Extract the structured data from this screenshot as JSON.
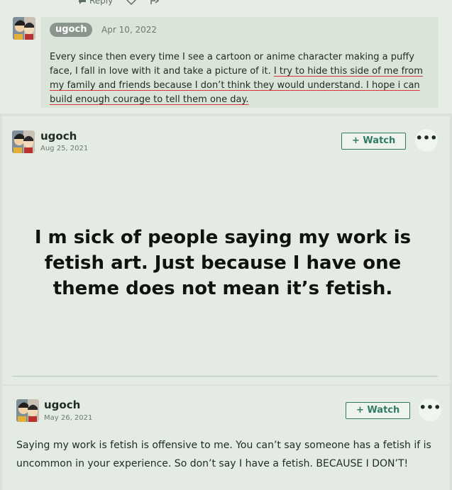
{
  "top_actions": {
    "reply_label": "Reply"
  },
  "comment": {
    "username": "ugoch",
    "date": "Apr 10, 2022",
    "text_plain": "Every since then every time I see a cartoon or anime character making a puffy face, I fall in love with it and take a picture of it. ",
    "text_underlined": "I try to hide this side of me from my family and friends because I don’t think they would understand. I hope i can build enough courage to tell them one day."
  },
  "post": {
    "username": "ugoch",
    "date": "Aug 25, 2021",
    "watch_label": "+ Watch",
    "more_label": "•••",
    "headline": "I m sick of people saying my work is fetish art. Just because I have one theme does not mean it’s fetish."
  },
  "post2": {
    "username": "ugoch",
    "date": "May 26, 2021",
    "watch_label": "+ Watch",
    "more_label": "•••",
    "text": "Saying my work is fetish is offensive to me. You can’t say someone has a fetish if is uncommon in your experience. So don’t say I have a fetish. BECAUSE I DON’T!"
  },
  "colors": {
    "accent": "#2f7a64",
    "underline": "#d6333a",
    "pill": "#8a958d"
  }
}
